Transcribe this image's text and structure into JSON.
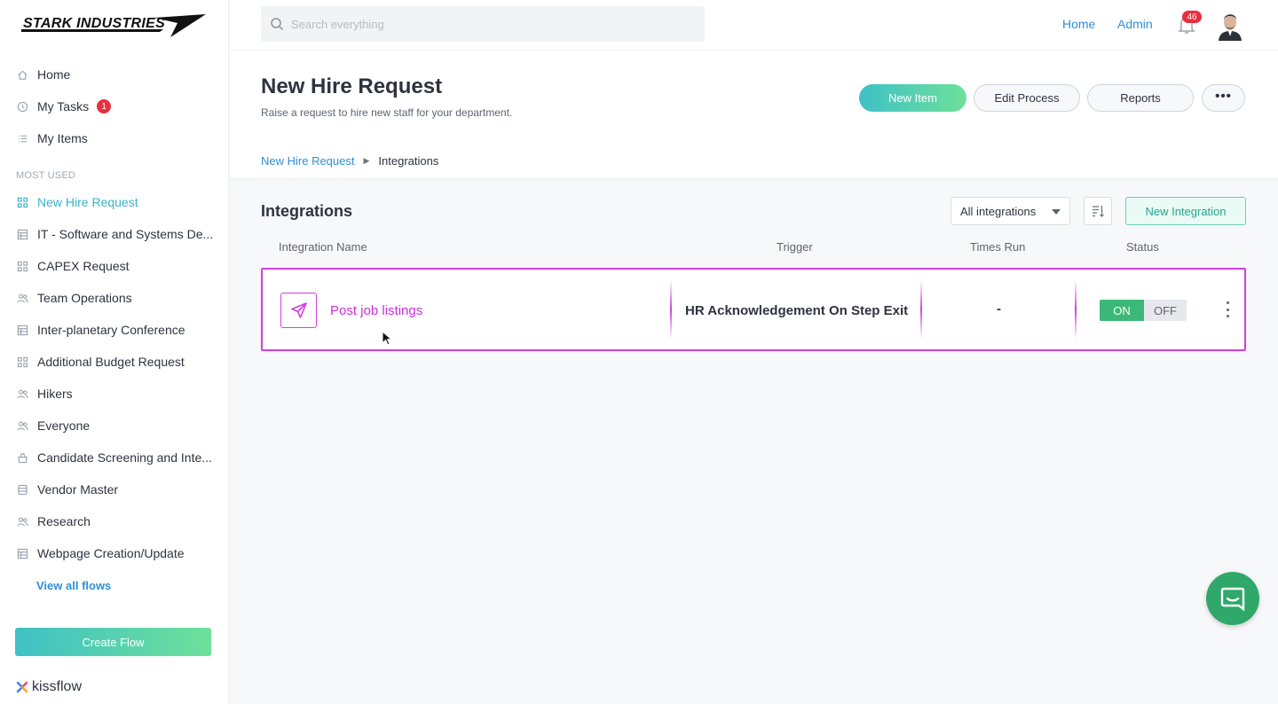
{
  "brand": {
    "logo_text": "STARK INDUSTRIES",
    "footer": "kissflow"
  },
  "sidebar": {
    "nav": [
      {
        "label": "Home",
        "icon": "home-icon"
      },
      {
        "label": "My Tasks",
        "icon": "clock-icon",
        "badge": "1"
      },
      {
        "label": "My Items",
        "icon": "list-icon"
      }
    ],
    "section_title": "MOST USED",
    "flows": [
      {
        "label": "New Hire Request",
        "icon": "flow-icon",
        "active": true
      },
      {
        "label": "IT - Software and Systems De...",
        "icon": "table-icon"
      },
      {
        "label": "CAPEX Request",
        "icon": "flow-icon"
      },
      {
        "label": "Team Operations",
        "icon": "people-icon"
      },
      {
        "label": "Inter-planetary Conference",
        "icon": "table-icon"
      },
      {
        "label": "Additional Budget Request",
        "icon": "flow-icon"
      },
      {
        "label": "Hikers",
        "icon": "people-icon"
      },
      {
        "label": "Everyone",
        "icon": "people-icon"
      },
      {
        "label": "Candidate Screening and Inte...",
        "icon": "bag-icon"
      },
      {
        "label": "Vendor Master",
        "icon": "database-icon"
      },
      {
        "label": "Research",
        "icon": "people-icon"
      },
      {
        "label": "Webpage Creation/Update",
        "icon": "table-icon"
      }
    ],
    "view_all": "View all flows",
    "create_flow": "Create Flow"
  },
  "topbar": {
    "search_placeholder": "Search everything",
    "links": [
      "Home",
      "Admin"
    ],
    "notifications": "46"
  },
  "header": {
    "title": "New Hire Request",
    "subtitle": "Raise a request to hire new staff for your department.",
    "buttons": {
      "new_item": "New Item",
      "edit_process": "Edit Process",
      "reports": "Reports",
      "more": "•••"
    },
    "breadcrumb": {
      "parent": "New Hire Request",
      "current": "Integrations"
    }
  },
  "integrations": {
    "title": "Integrations",
    "filter": "All integrations",
    "new_button": "New Integration",
    "columns": [
      "Integration Name",
      "Trigger",
      "Times Run",
      "Status"
    ],
    "rows": [
      {
        "name": "Post job listings",
        "trigger": "HR Acknowledgement On Step Exit",
        "times_run": "-",
        "status_on": "ON",
        "status_off": "OFF",
        "status": "ON"
      }
    ]
  },
  "colors": {
    "accent": "#3ab3c8",
    "link": "#2f8ed8",
    "highlight": "#d23fe0",
    "on": "#3cb878",
    "badge": "#e8303d"
  }
}
